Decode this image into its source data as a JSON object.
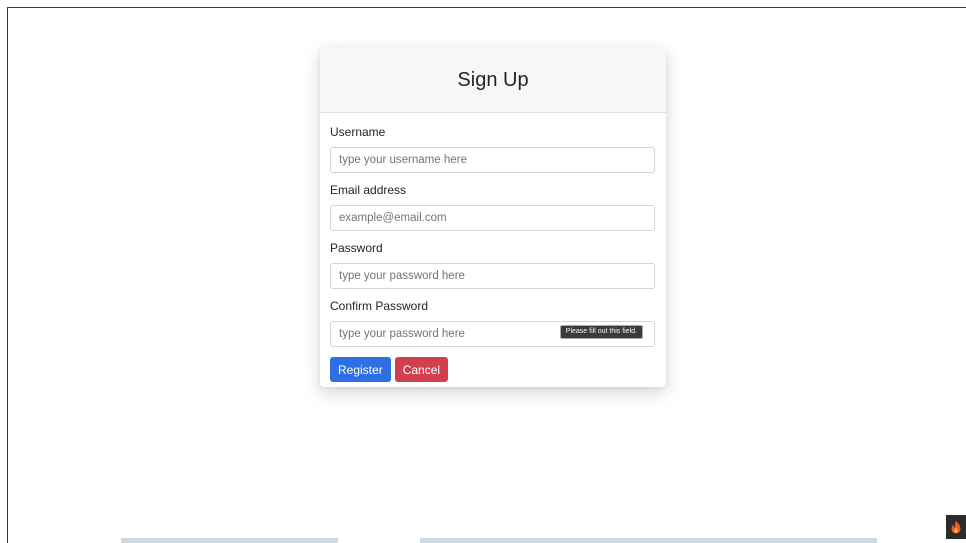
{
  "form": {
    "title": "Sign Up",
    "fields": [
      {
        "label": "Username",
        "placeholder": "type your username here",
        "type": "text"
      },
      {
        "label": "Email address",
        "placeholder": "example@email.com",
        "type": "email"
      },
      {
        "label": "Password",
        "placeholder": "type your password here",
        "type": "password"
      },
      {
        "label": "Confirm Password",
        "placeholder": "type your password here",
        "type": "password"
      }
    ],
    "validation_tooltip": "Please fill out this field.",
    "register_label": "Register",
    "cancel_label": "Cancel"
  },
  "icons": {
    "corner_badge": "flame-icon"
  },
  "colors": {
    "primary": "#2f6fe4",
    "danger": "#d2404d",
    "flame": "#f05a28"
  }
}
